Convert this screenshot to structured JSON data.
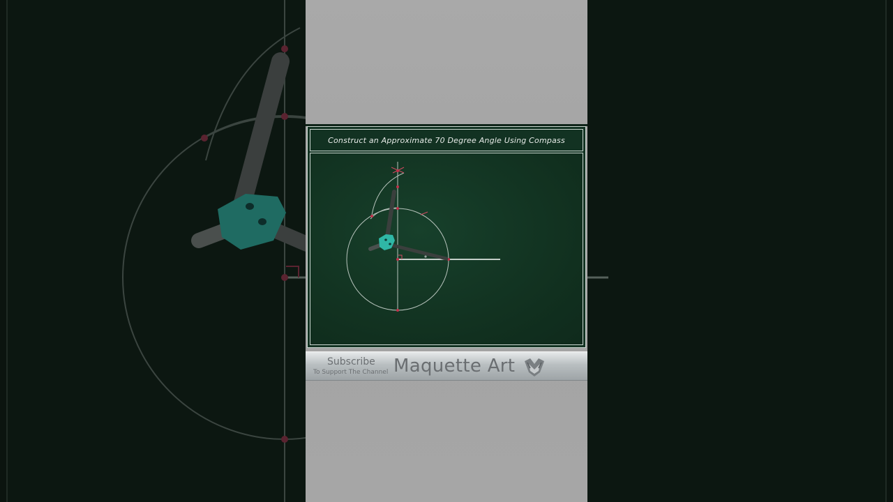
{
  "board": {
    "title": "Construct an Approximate 70 Degree Angle Using Compass"
  },
  "banner": {
    "subscribe": "Subscribe",
    "caption": "To Support The Channel",
    "brand": "Maquette Art"
  },
  "icons": {
    "compass": "compass-icon",
    "logo": "maquette-logo-icon"
  },
  "colors": {
    "board": "#123222",
    "construction_line": "#b8c4bd",
    "point": "#c0314a",
    "compass_head": "#2fb7a6",
    "compass_leg": "#3a3f3d",
    "ray": "#ffffff"
  }
}
